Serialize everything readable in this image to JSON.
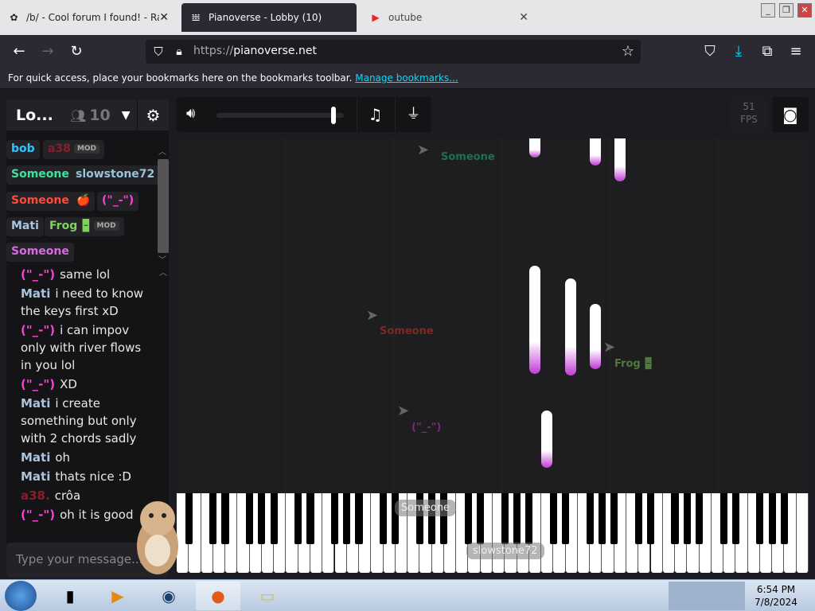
{
  "browser": {
    "tabs": [
      {
        "title": "/b/ - Cool forum I found! - Ran",
        "active": false
      },
      {
        "title": "Pianoverse - Lobby (10)",
        "active": true
      },
      {
        "title": "outube",
        "active": false
      }
    ],
    "url_protocol": "https://",
    "url_host": "pianoverse.net",
    "bookmark_hint": "For quick access, place your bookmarks here on the bookmarks toolbar.",
    "bookmark_link": "Manage bookmarks..."
  },
  "room": {
    "name": "Lo...",
    "count": "10"
  },
  "users": [
    {
      "name": "bob",
      "color": "#2ec4ff",
      "mod": false
    },
    {
      "name": "a38",
      "color": "#8a1d2a",
      "mod": true
    },
    {
      "name": "Someone",
      "color": "#3fe0a0",
      "mod": false
    },
    {
      "name": "slowstone72",
      "color": "#9ac3d8",
      "mod": false
    },
    {
      "name": "Someone",
      "color": "#ff4a3a",
      "mod": false
    },
    {
      "name": "🍎",
      "color": "#ff4a3a",
      "mod": false
    },
    {
      "name": "(\"_-\")",
      "color": "#ff3fd8",
      "mod": false
    },
    {
      "name": "Mati",
      "color": "#a8c4e0",
      "mod": false
    },
    {
      "name": "Frog 🁢",
      "color": "#7ed35a",
      "mod": true
    },
    {
      "name": "Someone",
      "color": "#d86ae0",
      "mod": false
    }
  ],
  "mod_tag": "MOD",
  "chat": [
    {
      "author": "(\"_-\")",
      "color": "#ff3fd8",
      "text": "same lol"
    },
    {
      "author": "Mati",
      "color": "#a8c4e0",
      "text": "i need to know the keys first xD"
    },
    {
      "author": "(\"_-\")",
      "color": "#ff3fd8",
      "text": "i can impov only with river flows in you lol"
    },
    {
      "author": "(\"_-\")",
      "color": "#ff3fd8",
      "text": "XD"
    },
    {
      "author": "Mati",
      "color": "#a8c4e0",
      "text": "i create something but only with 2 chords sadly"
    },
    {
      "author": "Mati",
      "color": "#a8c4e0",
      "text": "oh"
    },
    {
      "author": "Mati",
      "color": "#a8c4e0",
      "text": "thats nice :D"
    },
    {
      "author": "a38.",
      "color": "#8a1d2a",
      "text": "crôa"
    },
    {
      "author": "(\"_-\")",
      "color": "#ff3fd8",
      "text": "oh it is good"
    }
  ],
  "chat_placeholder": "Type your message...",
  "fps": {
    "value": "51",
    "label": "FPS"
  },
  "volume_level": 0.92,
  "cursors": [
    {
      "name": "Someone",
      "color": "#1f6f55"
    },
    {
      "name": "Someone",
      "color": "#7a2a22"
    },
    {
      "name": "Frog 🁢",
      "color": "#4f7a3a"
    },
    {
      "name": "(\"_-\")",
      "color": "#7a2a7a"
    }
  ],
  "key_labels": [
    "Someone",
    "slowstone72"
  ],
  "clock": {
    "time": "6:54 PM",
    "date": "7/8/2024"
  },
  "icons": {
    "back": "arrow-left-icon",
    "forward": "arrow-right-icon",
    "reload": "reload-icon",
    "shield": "shield-icon",
    "lock": "lock-icon",
    "star": "star-icon",
    "pocket": "pocket-icon",
    "download": "download-icon",
    "extensions": "extensions-icon",
    "menu": "menu-icon",
    "volume": "volume-icon",
    "music": "music-note-icon",
    "plugin": "plug-icon",
    "discord": "discord-icon",
    "settings": "gear-icon",
    "people": "people-icon"
  }
}
